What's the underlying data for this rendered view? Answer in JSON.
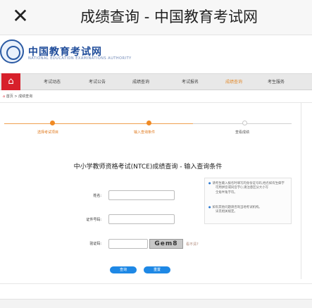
{
  "app": {
    "close_icon": "close-icon",
    "title": "成绩查询 - 中国教育考试网"
  },
  "site": {
    "logo_text": "中国教育考试网",
    "logo_sub": "NATIONAL EDUCATION EXAMINATIONS AUTHORITY",
    "logo_icon": "seal-icon"
  },
  "nav": {
    "home_icon": "home-icon",
    "items": [
      {
        "label": "考试动态",
        "active": false
      },
      {
        "label": "考试公告",
        "active": false
      },
      {
        "label": "成绩查询",
        "active": false
      },
      {
        "label": "考试报名",
        "active": false
      },
      {
        "label": "成绩查询",
        "active": true
      },
      {
        "label": "考生服务",
        "active": false
      }
    ]
  },
  "breadcrumb": {
    "home": "首页",
    "path": "首页 > 成绩查询"
  },
  "steps": [
    {
      "label": "选择考试项目",
      "active": true
    },
    {
      "label": "输入查询条件",
      "active": true
    },
    {
      "label": "查看成绩",
      "active": false
    }
  ],
  "form": {
    "title": "中小学教师资格考试(NTCE)成绩查询 - 输入查询条件",
    "fields": [
      {
        "label": "姓名:",
        "value": "",
        "placeholder": ""
      },
      {
        "label": "证件号码:",
        "value": "",
        "placeholder": ""
      },
      {
        "label": "验证码:",
        "value": "",
        "placeholder": ""
      }
    ],
    "captcha_text": "Gem8",
    "refresh_label": "看不清?",
    "submit_label": "查询",
    "reset_label": "重置"
  },
  "notes": {
    "lines": [
      "请考生输入报名时填写的身份证号码,姓名如有生僻字",
      "可用拼音或同音字(),请注意区分大小写",
      "全角半角字符。",
      "如有其他问题请咨询当地考试机构。",
      "详见相关规定。"
    ]
  },
  "colors": {
    "accent": "#1e88e5",
    "step_active": "#f08a24",
    "nav_home": "#d7202b",
    "logo_blue": "#1f4c9a"
  }
}
